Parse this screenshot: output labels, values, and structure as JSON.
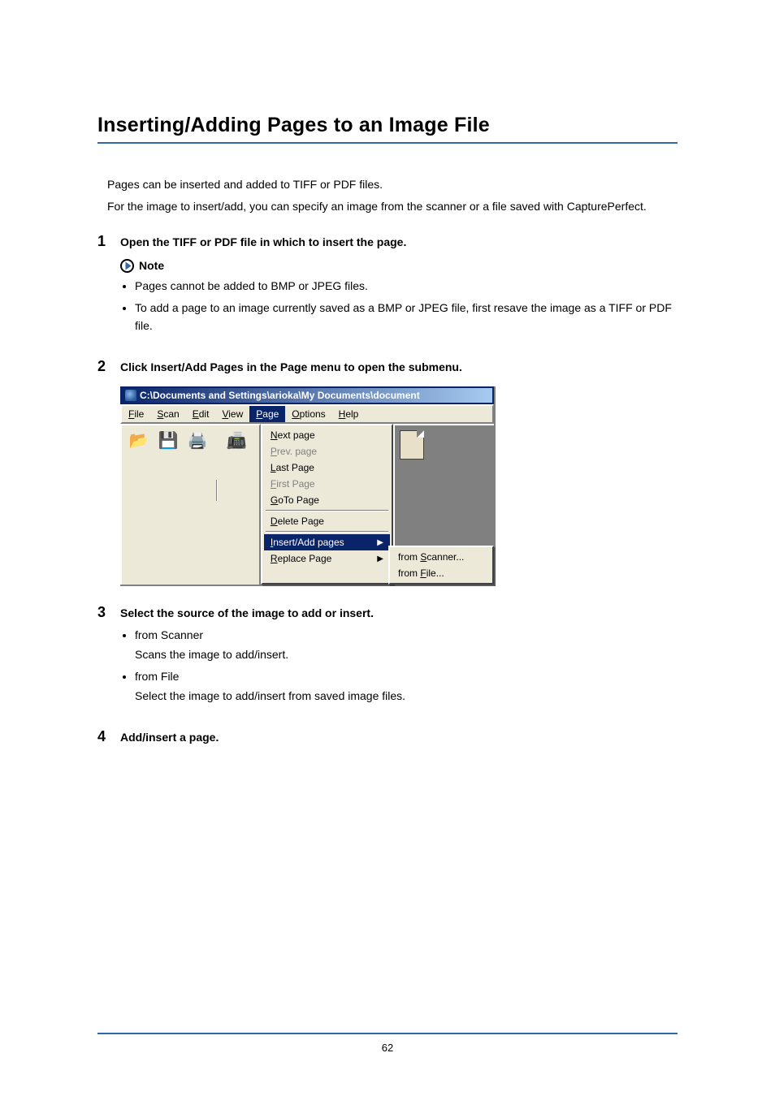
{
  "title": "Inserting/Adding Pages to an Image File",
  "intro": {
    "p1": "Pages can be inserted and added to TIFF or PDF files.",
    "p2": "For the image to insert/add, you can specify an image from the scanner or a file saved with CapturePerfect."
  },
  "note_label": "Note",
  "steps": [
    {
      "num": "1",
      "head": "Open the TIFF or PDF file in which to insert the page.",
      "notes": [
        "Pages cannot be added to BMP or JPEG files.",
        "To add a page to an image currently saved as a BMP or JPEG file, first resave the image as a TIFF or PDF file."
      ]
    },
    {
      "num": "2",
      "head": "Click Insert/Add Pages in the Page menu to open the submenu."
    },
    {
      "num": "3",
      "head": "Select the source of the image to add or insert.",
      "options": [
        {
          "name": "from Scanner",
          "desc": "Scans the image to add/insert."
        },
        {
          "name": "from File",
          "desc": "Select the image to add/insert from saved image files."
        }
      ]
    },
    {
      "num": "4",
      "head": "Add/insert a page."
    }
  ],
  "app": {
    "titlebar": "C:\\Documents and Settings\\arioka\\My Documents\\document",
    "menubar": {
      "file": "File",
      "scan": "Scan",
      "edit": "Edit",
      "view": "View",
      "page": "Page",
      "options": "Options",
      "help": "Help",
      "file_u": "F",
      "scan_u": "S",
      "edit_u": "E",
      "view_u": "V",
      "page_u": "P",
      "options_u": "O",
      "help_u": "H"
    },
    "page_menu": {
      "next": "Next page",
      "next_u": "N",
      "prev": "Prev. page",
      "prev_u": "P",
      "last": "Last Page",
      "last_u": "L",
      "first": "First Page",
      "first_u": "F",
      "goto": "GoTo Page",
      "goto_u": "G",
      "delete": "Delete Page",
      "delete_u": "D",
      "insert": "Insert/Add pages",
      "insert_u": "I",
      "replace": "Replace Page",
      "replace_u": "R"
    },
    "submenu": {
      "scanner": "from Scanner...",
      "scanner_u": "S",
      "file": "from File...",
      "file_u": "F"
    }
  },
  "page_number": "62"
}
